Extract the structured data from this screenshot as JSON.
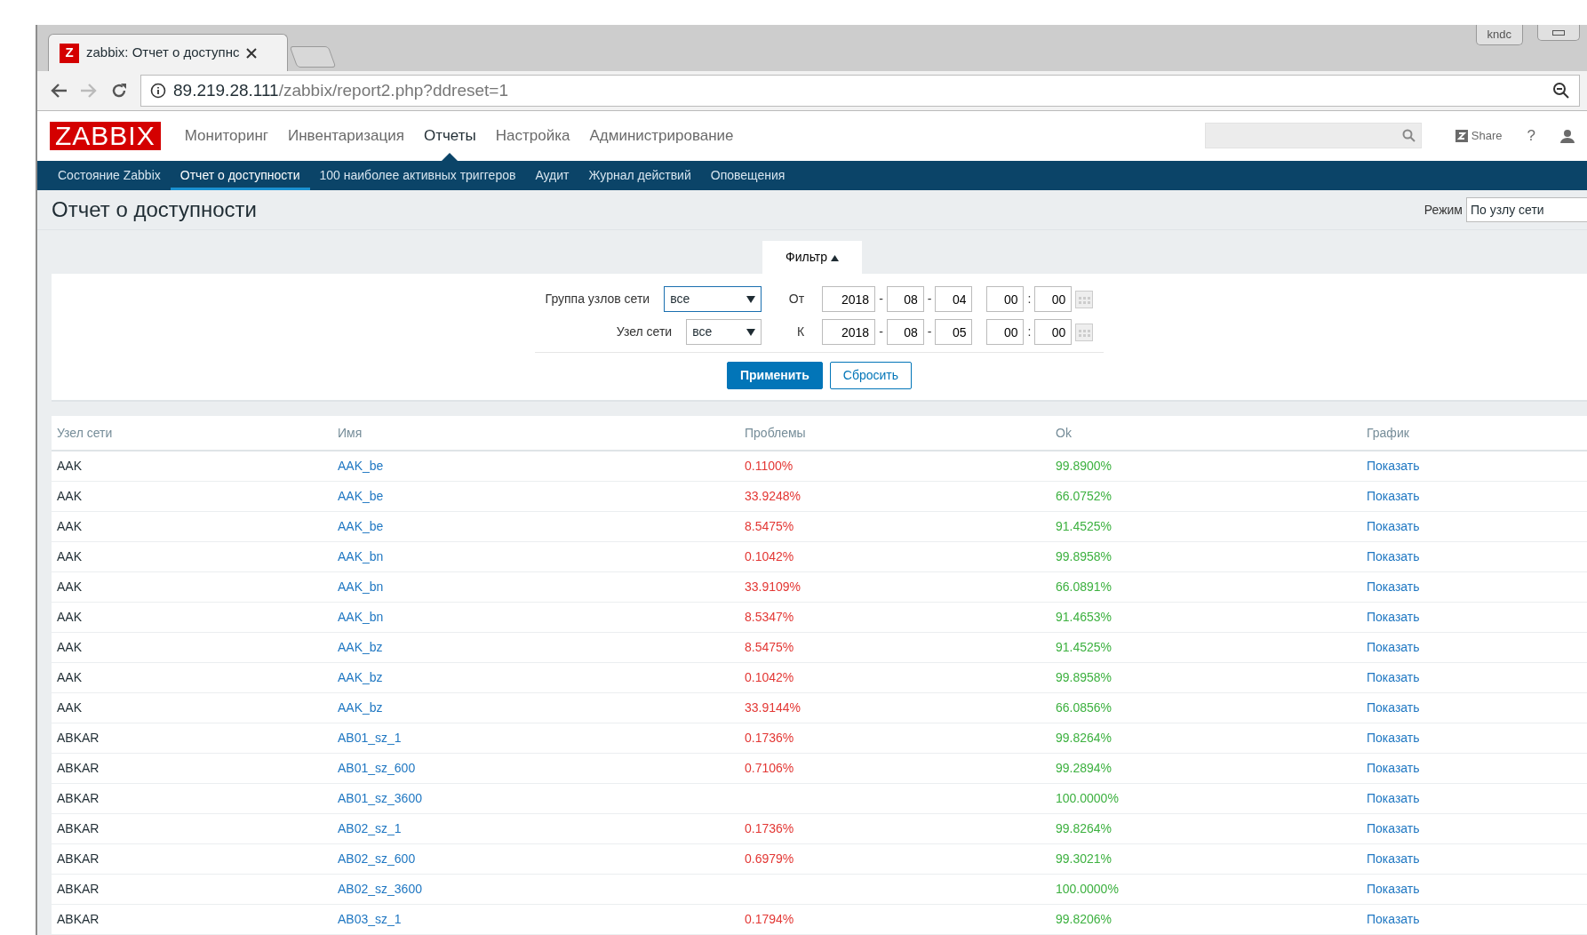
{
  "browser": {
    "tab_title": "zabbix: Отчет о доступнс",
    "url_host": "89.219.28.111",
    "url_path": "/zabbix/report2.php?ddreset=1",
    "profile": "kndc",
    "favicon": "Z"
  },
  "header": {
    "logo": "ZABBIX",
    "menu": [
      {
        "label": "Мониторинг",
        "selected": false
      },
      {
        "label": "Инвентаризация",
        "selected": false
      },
      {
        "label": "Отчеты",
        "selected": true
      },
      {
        "label": "Настройка",
        "selected": false
      },
      {
        "label": "Администрирование",
        "selected": false
      }
    ],
    "share": "Share",
    "help": "?"
  },
  "subnav": [
    {
      "label": "Состояние Zabbix",
      "selected": false
    },
    {
      "label": "Отчет о доступности",
      "selected": true
    },
    {
      "label": "100 наиболее активных триггеров",
      "selected": false
    },
    {
      "label": "Аудит",
      "selected": false
    },
    {
      "label": "Журнал действий",
      "selected": false
    },
    {
      "label": "Оповещения",
      "selected": false
    }
  ],
  "page": {
    "title": "Отчет о доступности",
    "mode_label": "Режим",
    "mode_value": "По узлу сети"
  },
  "filter": {
    "tab_label": "Фильтр",
    "expanded": true,
    "host_group_label": "Группа узлов сети",
    "host_group_value": "все",
    "host_label": "Узел сети",
    "host_value": "все",
    "from_label": "От",
    "from": [
      "2018",
      "08",
      "04",
      "00",
      "00"
    ],
    "to_label": "К",
    "to": [
      "2018",
      "08",
      "05",
      "00",
      "00"
    ],
    "date_separator": "-",
    "time_separator": ":",
    "apply": "Применить",
    "reset": "Сбросить"
  },
  "table": {
    "columns": [
      "Узел сети",
      "Имя",
      "Проблемы",
      "Ok",
      "График"
    ],
    "rows": [
      {
        "host": "AAK",
        "name": "AAK_be",
        "problems": "0.1100%",
        "ok": "99.8900%",
        "graph": "Показать"
      },
      {
        "host": "AAK",
        "name": "AAK_be",
        "problems": "33.9248%",
        "ok": "66.0752%",
        "graph": "Показать"
      },
      {
        "host": "AAK",
        "name": "AAK_be",
        "problems": "8.5475%",
        "ok": "91.4525%",
        "graph": "Показать"
      },
      {
        "host": "AAK",
        "name": "AAK_bn",
        "problems": "0.1042%",
        "ok": "99.8958%",
        "graph": "Показать"
      },
      {
        "host": "AAK",
        "name": "AAK_bn",
        "problems": "33.9109%",
        "ok": "66.0891%",
        "graph": "Показать"
      },
      {
        "host": "AAK",
        "name": "AAK_bn",
        "problems": "8.5347%",
        "ok": "91.4653%",
        "graph": "Показать"
      },
      {
        "host": "AAK",
        "name": "AAK_bz",
        "problems": "8.5475%",
        "ok": "91.4525%",
        "graph": "Показать"
      },
      {
        "host": "AAK",
        "name": "AAK_bz",
        "problems": "0.1042%",
        "ok": "99.8958%",
        "graph": "Показать"
      },
      {
        "host": "AAK",
        "name": "AAK_bz",
        "problems": "33.9144%",
        "ok": "66.0856%",
        "graph": "Показать"
      },
      {
        "host": "ABKAR",
        "name": "AB01_sz_1",
        "problems": "0.1736%",
        "ok": "99.8264%",
        "graph": "Показать"
      },
      {
        "host": "ABKAR",
        "name": "AB01_sz_600",
        "problems": "0.7106%",
        "ok": "99.2894%",
        "graph": "Показать"
      },
      {
        "host": "ABKAR",
        "name": "AB01_sz_3600",
        "ok": "100.0000%",
        "graph": "Показать"
      },
      {
        "host": "ABKAR",
        "name": "AB02_sz_1",
        "problems": "0.1736%",
        "ok": "99.8264%",
        "graph": "Показать"
      },
      {
        "host": "ABKAR",
        "name": "AB02_sz_600",
        "problems": "0.6979%",
        "ok": "99.3021%",
        "graph": "Показать"
      },
      {
        "host": "ABKAR",
        "name": "AB02_sz_3600",
        "ok": "100.0000%",
        "graph": "Показать"
      },
      {
        "host": "ABKAR",
        "name": "AB03_sz_1",
        "problems": "0.1794%",
        "ok": "99.8206%",
        "graph": "Показать"
      }
    ]
  }
}
